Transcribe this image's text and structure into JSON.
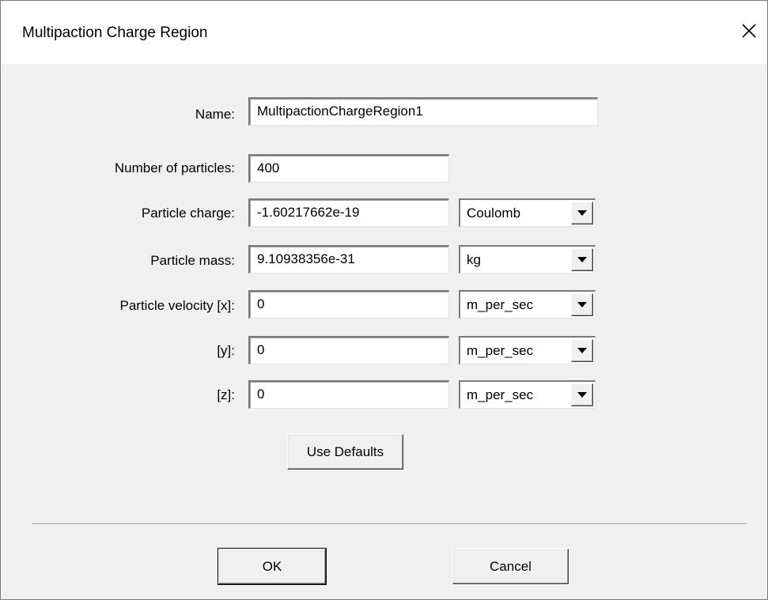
{
  "dialog": {
    "title": "Multipaction Charge Region",
    "close_icon": "close-icon"
  },
  "form": {
    "name_label": "Name:",
    "name_value": "MultipactionChargeRegion1",
    "particles_label": "Number of particles:",
    "particles_value": "400",
    "charge_label": "Particle charge:",
    "charge_value": "-1.60217662e-19",
    "charge_unit": "Coulomb",
    "mass_label": "Particle mass:",
    "mass_value": "9.10938356e-31",
    "mass_unit": "kg",
    "vx_label": "Particle velocity [x]:",
    "vx_value": "0",
    "vx_unit": "m_per_sec",
    "vy_label": "[y]:",
    "vy_value": "0",
    "vy_unit": "m_per_sec",
    "vz_label": "[z]:",
    "vz_value": "0",
    "vz_unit": "m_per_sec",
    "use_defaults_label": "Use Defaults"
  },
  "footer": {
    "ok_label": "OK",
    "cancel_label": "Cancel"
  }
}
